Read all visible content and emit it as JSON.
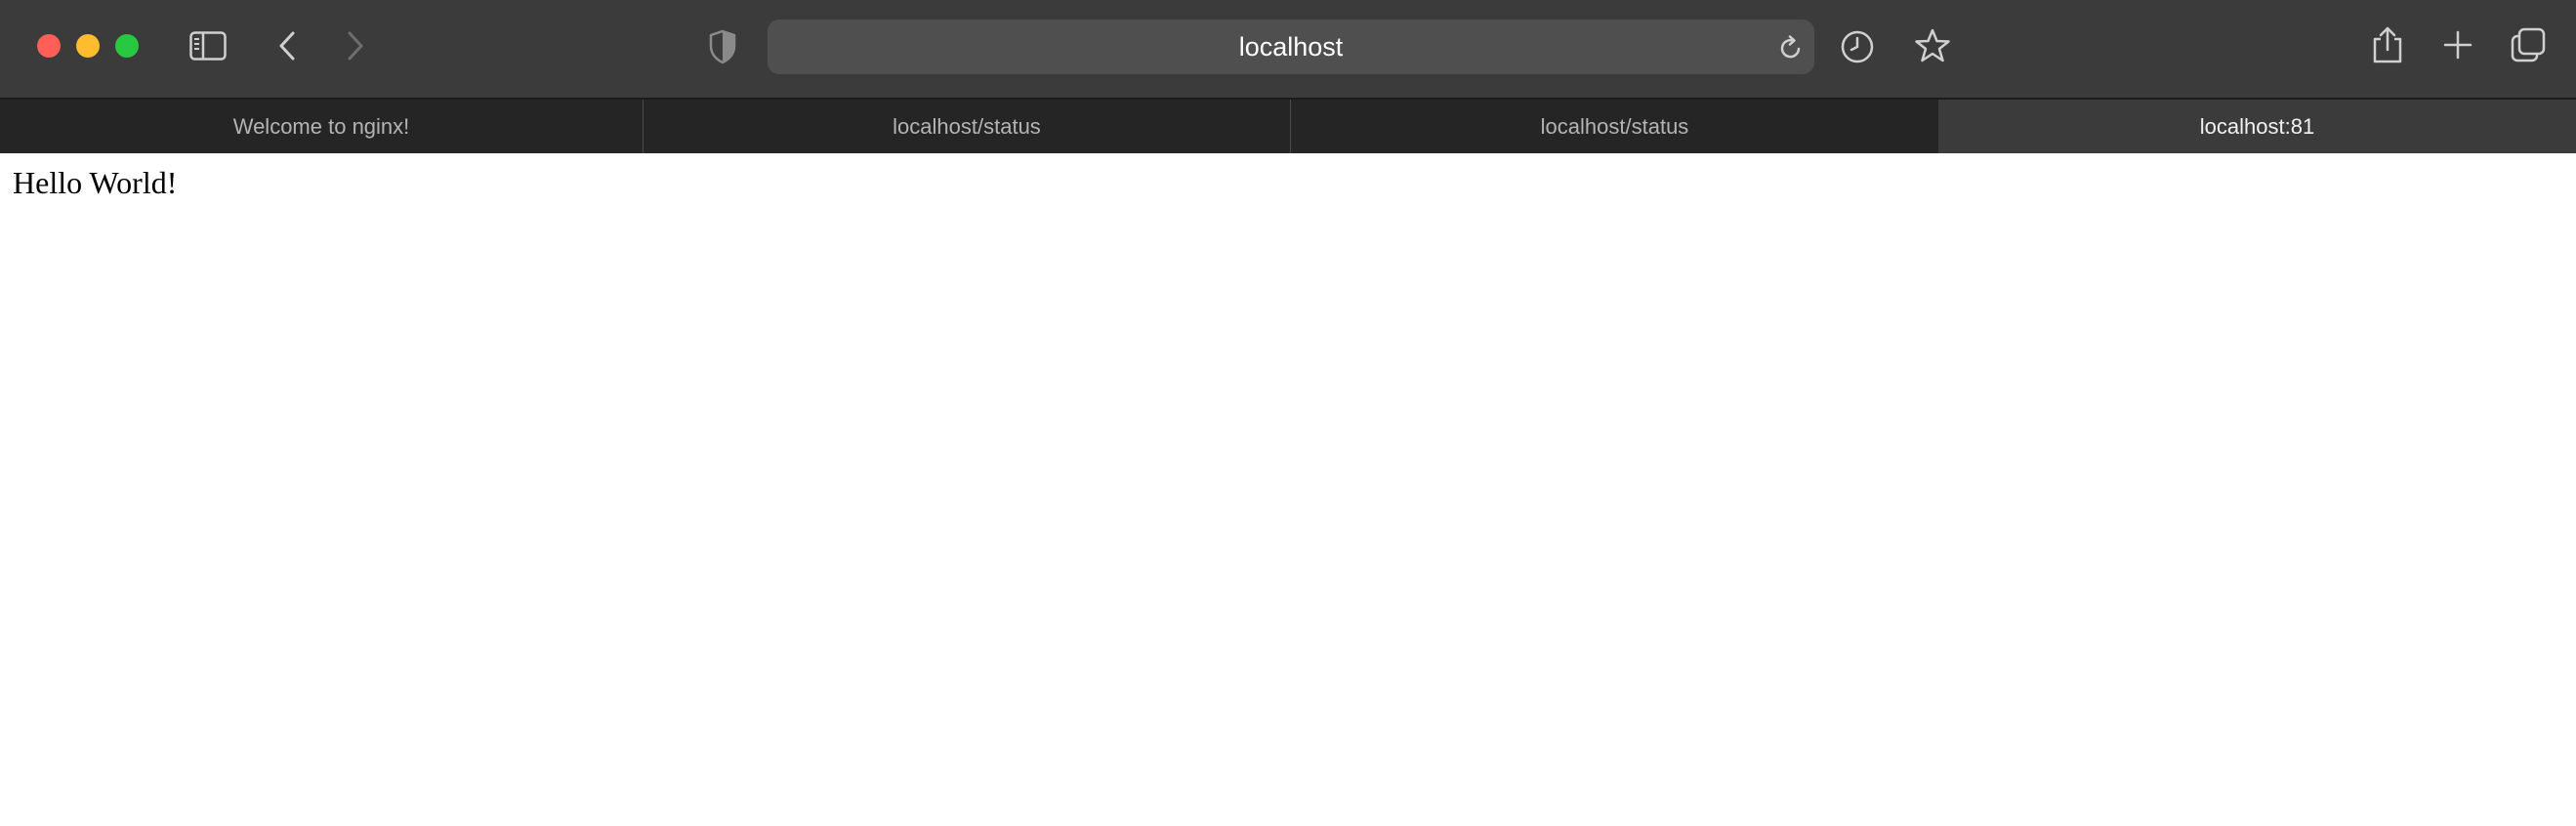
{
  "address_bar": {
    "url": "localhost"
  },
  "tabs": [
    {
      "label": "Welcome to nginx!",
      "active": false
    },
    {
      "label": "localhost/status",
      "active": false
    },
    {
      "label": "localhost/status",
      "active": false
    },
    {
      "label": "localhost:81",
      "active": true
    }
  ],
  "page": {
    "text": "Hello World!"
  },
  "icons": {
    "sidebar": "sidebar-icon",
    "back": "chevron-left-icon",
    "forward": "chevron-right-icon",
    "privacy": "shield-icon",
    "reload": "reload-icon",
    "history": "clock-icon",
    "bookmark": "star-icon",
    "share": "share-icon",
    "new_tab": "plus-icon",
    "tab_overview": "tabs-overview-icon"
  },
  "colors": {
    "toolbar": "#3b3b3b",
    "tabbar": "#252525",
    "close": "#ff5f57",
    "minimize": "#febc2e",
    "zoom": "#28c840"
  }
}
